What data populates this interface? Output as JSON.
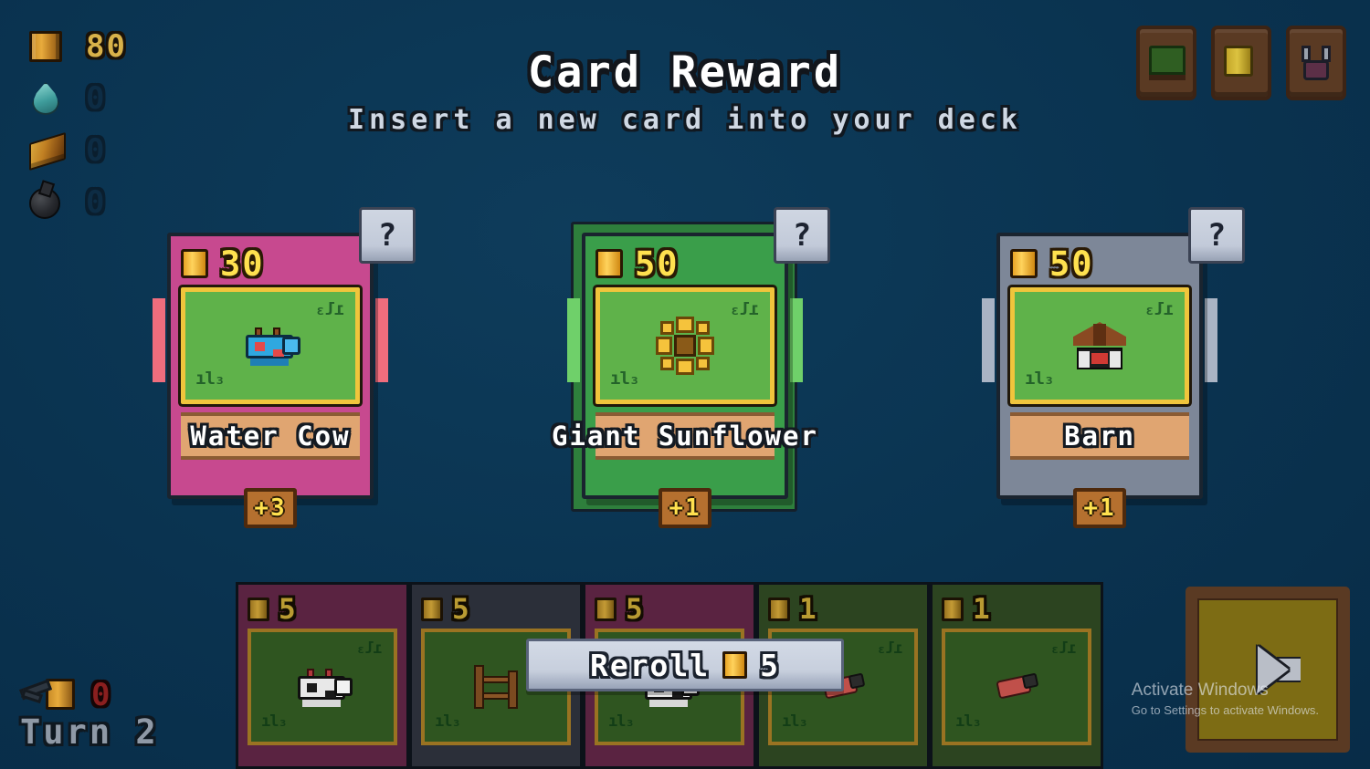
{
  "header": {
    "title": "Card Reward",
    "subtitle": "Insert a new card into your deck"
  },
  "resources": [
    {
      "name": "coin",
      "icon": "coin-block-icon",
      "value": "80",
      "dim": false
    },
    {
      "name": "water",
      "icon": "water-droplet-icon",
      "value": "0",
      "dim": true
    },
    {
      "name": "wood",
      "icon": "wood-plank-icon",
      "value": "0",
      "dim": true
    },
    {
      "name": "bomb",
      "icon": "bomb-icon",
      "value": "0",
      "dim": true
    }
  ],
  "topbar": {
    "buttons": [
      {
        "name": "deck-button",
        "icon": "deck-icon"
      },
      {
        "name": "shop-button",
        "icon": "gold-card-icon"
      },
      {
        "name": "potion-button",
        "icon": "potion-icon"
      }
    ]
  },
  "reward_cards": [
    {
      "name": "Water Cow",
      "cost": "30",
      "badge": "+3",
      "help": "?",
      "body_color": "#c7498f",
      "stripe_color": "#ef6d7d",
      "back_color": "#a93b78",
      "sprite": "cow",
      "has_back": false
    },
    {
      "name": "Giant Sunflower",
      "cost": "50",
      "badge": "+1",
      "help": "?",
      "body_color": "#3a9e4a",
      "stripe_color": "#6fd06a",
      "back_color": "#2e7f3c",
      "sprite": "sunflower",
      "has_back": true
    },
    {
      "name": "Barn",
      "cost": "50",
      "badge": "+1",
      "help": "?",
      "body_color": "#7d8798",
      "stripe_color": "#aab4c4",
      "back_color": "#6a7383",
      "sprite": "barn",
      "has_back": false
    }
  ],
  "hand_cards": [
    {
      "cost": "5",
      "sprite": "cow-bw",
      "body_color": "#5a2341"
    },
    {
      "cost": "5",
      "sprite": "fence",
      "body_color": "#2b2f39"
    },
    {
      "cost": "5",
      "sprite": "cow-bw",
      "body_color": "#5a2341"
    },
    {
      "cost": "1",
      "sprite": "pig",
      "body_color": "#2c4420"
    },
    {
      "cost": "1",
      "sprite": "pig",
      "body_color": "#2c4420"
    }
  ],
  "reroll": {
    "label": "Reroll",
    "cost": "5",
    "coin_icon": "coin-icon"
  },
  "end_turn": {
    "name": "end-turn-button",
    "icon": "arrow-right-icon"
  },
  "status": {
    "tool_icon": "tool-block-icon",
    "tool_value": "0",
    "turn_label": "Turn 2"
  },
  "watermark": {
    "title": "Activate Windows",
    "subtitle": "Go to Settings to activate Windows."
  },
  "colors": {
    "background": "#0b3450",
    "accent_gold": "#ffe14f",
    "banner_tan": "#e0a571",
    "art_green": "#5fb24a"
  }
}
